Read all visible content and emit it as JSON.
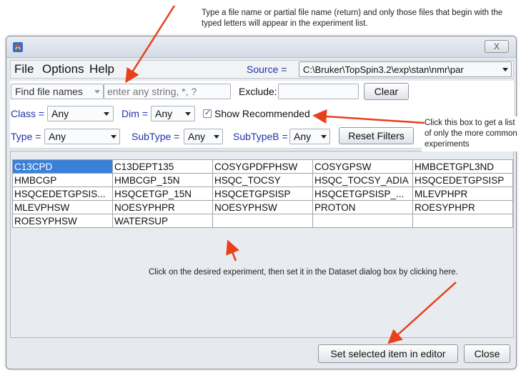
{
  "annotations": {
    "top": "Type a file name or partial file name (return) and only those files that begin with the typed letters will appear in the experiment list.",
    "right": "Click this box to get a list of only the more common experiments",
    "bottom": "Click on the desired experiment, then set it in the Dataset dialog box by clicking here."
  },
  "window": {
    "app_icon": "java-app-icon",
    "close_label": "X"
  },
  "menu": {
    "file": "File",
    "options": "Options",
    "help": "Help",
    "source_label": "Source =",
    "source_value": "C:\\Bruker\\TopSpin3.2\\exp\\stan\\nmr\\par"
  },
  "filters": {
    "find_mode": "Find file names",
    "find_placeholder": "enter any string, *, ?",
    "exclude_label": "Exclude:",
    "exclude_value": "",
    "clear_label": "Clear",
    "class_label": "Class =",
    "class_value": "Any",
    "dim_label": "Dim =",
    "dim_value": "Any",
    "show_recommended_label": "Show Recommended",
    "show_recommended_checked": true,
    "type_label": "Type =",
    "type_value": "Any",
    "subtype_label": "SubType =",
    "subtype_value": "Any",
    "subtypeb_label": "SubTypeB =",
    "subtypeb_value": "Any",
    "reset_label": "Reset Filters"
  },
  "experiments": [
    [
      "C13CPD",
      "C13DEPT135",
      "COSYGPDFPHSW",
      "COSYGPSW",
      "HMBCETGPL3ND"
    ],
    [
      "HMBCGP",
      "HMBCGP_15N",
      "HSQC_TOCSY",
      "HSQC_TOCSY_ADIA",
      "HSQCEDETGPSISP"
    ],
    [
      "HSQCEDETGPSIS...",
      "HSQCETGP_15N",
      "HSQCETGPSISP",
      "HSQCETGPSISP_...",
      "MLEVPHPR"
    ],
    [
      "MLEVPHSW",
      "NOESYPHPR",
      "NOESYPHSW",
      "PROTON",
      "ROESYPHPR"
    ],
    [
      "ROESYPHSW",
      "WATERSUP",
      "",
      "",
      ""
    ]
  ],
  "selected_experiment": "C13CPD",
  "footer": {
    "set_label": "Set selected item in editor",
    "close_label": "Close"
  },
  "colors": {
    "selection": "#3a80d9",
    "label_blue": "#2233a8",
    "annotation_arrow": "#e8401c"
  }
}
